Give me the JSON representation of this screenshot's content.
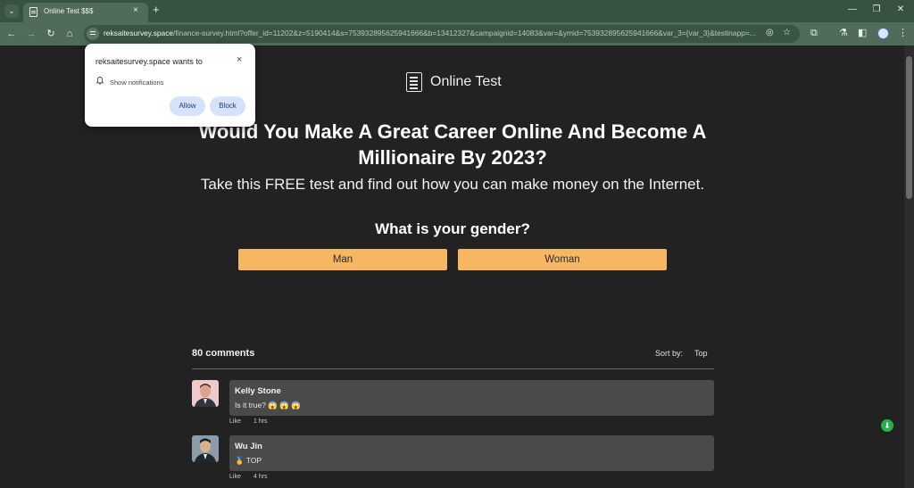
{
  "browser": {
    "tab_title": "Online Test $$$",
    "tab_close": "×",
    "new_tab": "+",
    "window_controls": {
      "minimize": "—",
      "restore": "❐",
      "close": "✕"
    },
    "url_host": "reksaitesurvey.space",
    "url_path": "/finance-survey.html?offer_id=11202&z=5190414&s=753932895625941666&b=13412327&campaignid=14083&var=&ymid=753932895625941666&var_3={var_3}&testinapp=..."
  },
  "permission_prompt": {
    "title": "reksaitesurvey.space wants to",
    "permission": "Show notifications",
    "allow_label": "Allow",
    "block_label": "Block",
    "close": "×"
  },
  "page": {
    "brand": "Online Test",
    "headline": "Would You Make A Great Career Online And Become A Millionaire By 2023?",
    "subline": "Take this FREE test and find out how you can make money on the Internet.",
    "question": "What is your gender?",
    "answers": [
      "Man",
      "Woman"
    ],
    "accent_color": "#f7b660"
  },
  "comments": {
    "count_label": "80 comments",
    "sort_label": "Sort by:",
    "sort_value": "Top",
    "items": [
      {
        "name": "Kelly Stone",
        "text": "Is it true? 😱 😱 😱",
        "like": "Like",
        "time": "1 hrs"
      },
      {
        "name": "Wu Jin",
        "text": "🥇 TOP",
        "like": "Like",
        "time": "4 hrs"
      }
    ]
  }
}
